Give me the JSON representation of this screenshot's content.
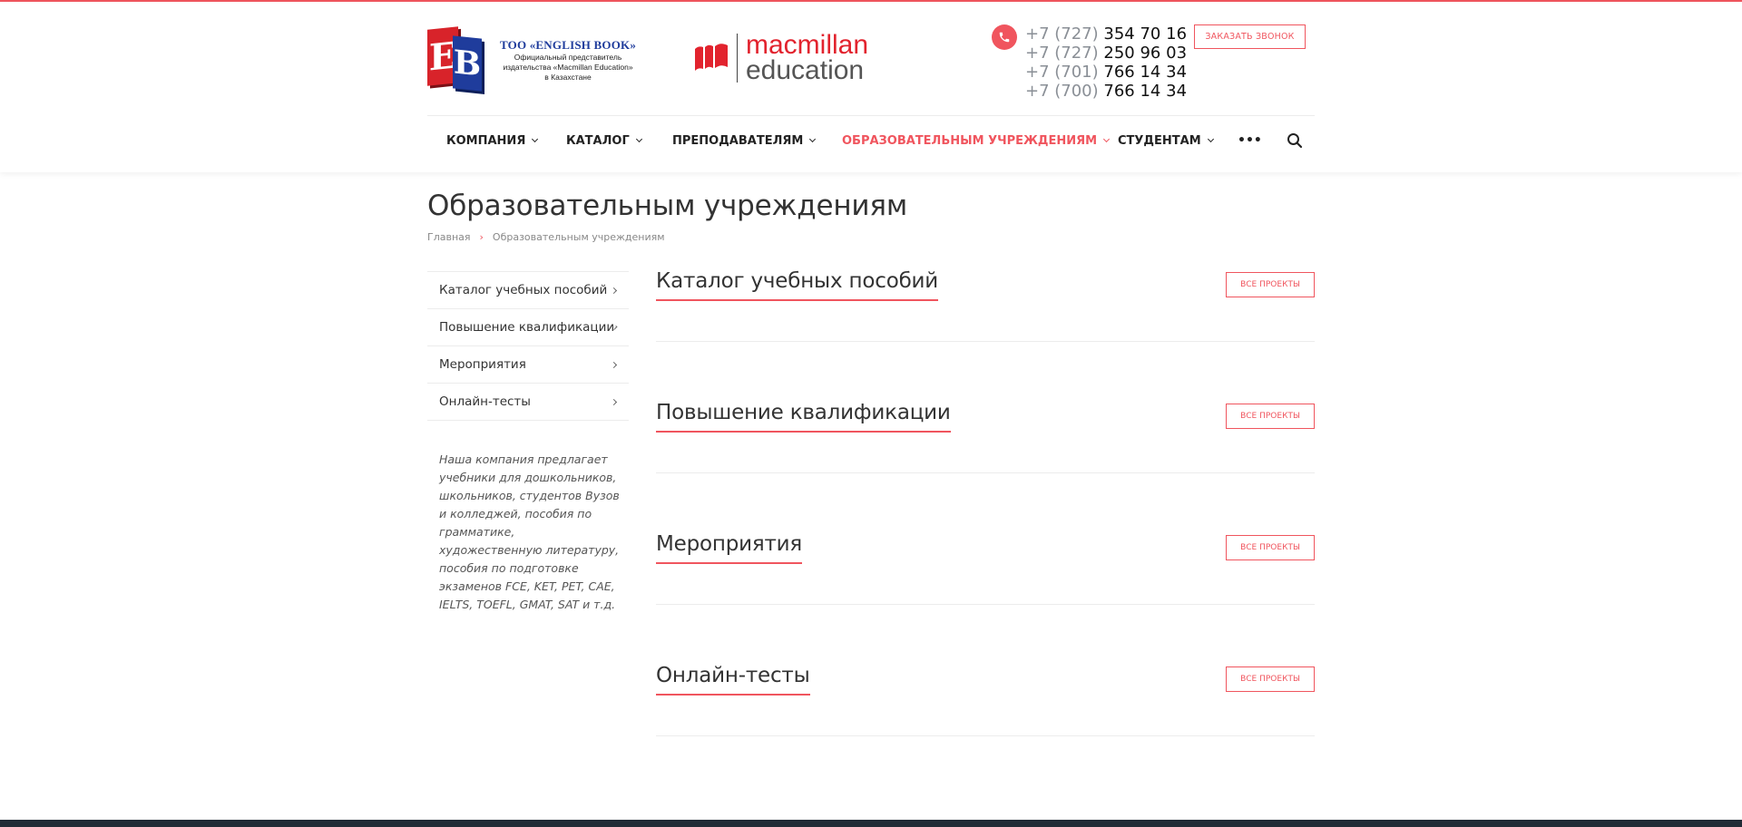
{
  "colors": {
    "accent": "#f0555e",
    "footer": "#212b36",
    "eb_red": "#d8232a",
    "eb_blue": "#1f3c9c"
  },
  "header": {
    "eb_logo": {
      "letters": [
        "E",
        "B"
      ],
      "title": "ТОО «ENGLISH BOOK»",
      "subtitle_lines": [
        "Официальный представитель",
        "издательства «Macmillan Education»",
        "в Казахстане"
      ]
    },
    "macmillan_logo": {
      "line1": "macmillan",
      "line2": "education"
    },
    "phone_icon": "phone-icon",
    "phones": [
      {
        "code": "+7 (727)",
        "number": "354 70 16"
      },
      {
        "code": "+7 (727)",
        "number": "250 96 03"
      },
      {
        "code": "+7 (701)",
        "number": "766 14 34"
      },
      {
        "code": "+7 (700)",
        "number": "766 14 34"
      }
    ],
    "callback_label": "ЗАКАЗАТЬ ЗВОНОК"
  },
  "nav": {
    "items": [
      {
        "label": "КОМПАНИЯ",
        "active": false
      },
      {
        "label": "КАТАЛОГ",
        "active": false
      },
      {
        "label": "ПРЕПОДАВАТЕЛЯМ",
        "active": false
      },
      {
        "label": "ОБРАЗОВАТЕЛЬНЫМ УЧРЕЖДЕНИЯМ",
        "active": true
      },
      {
        "label": "СТУДЕНТАМ",
        "active": false
      }
    ],
    "more": "•••",
    "search_icon": "search-icon"
  },
  "page": {
    "title": "Образовательным учреждениям",
    "breadcrumb": {
      "home": "Главная",
      "current": "Образовательным учреждениям"
    }
  },
  "sidebar": {
    "items": [
      {
        "label": "Каталог учебных пособий"
      },
      {
        "label": "Повышение квалификации"
      },
      {
        "label": "Мероприятия"
      },
      {
        "label": "Онлайн-тесты"
      }
    ],
    "description": "Наша компания предлагает учебники для дошкольников, школьников, студентов Вузов и колледжей, пособия по грамматике, художественную литературу, пособия по подготовке экзаменов FCE, KET, PET, CAE, IELTS, TOEFL, GMAT, SAT и т.д."
  },
  "sections": [
    {
      "title": "Каталог учебных пособий",
      "button": "ВСЕ ПРОЕКТЫ"
    },
    {
      "title": "Повышение квалификации",
      "button": "ВСЕ ПРОЕКТЫ"
    },
    {
      "title": "Мероприятия",
      "button": "ВСЕ ПРОЕКТЫ"
    },
    {
      "title": "Онлайн-тесты",
      "button": "ВСЕ ПРОЕКТЫ"
    }
  ]
}
